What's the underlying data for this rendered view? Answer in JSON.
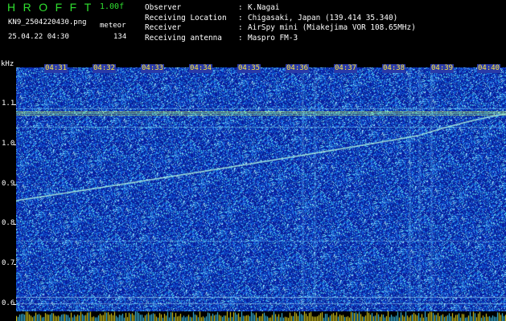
{
  "header": {
    "app_title": "HROFFT",
    "version": "1.00f",
    "filename": "KN9_2504220430.png",
    "mode": "meteor",
    "datetime": "25.04.22 04:30",
    "count": "134"
  },
  "meta": [
    {
      "key": "Observer",
      "value": "K.Nagai"
    },
    {
      "key": "Receiving Location",
      "value": "Chigasaki, Japan (139.414 35.340)"
    },
    {
      "key": "Receiver",
      "value": "AirSpy mini (Miakejima VOR 108.65MHz)"
    },
    {
      "key": "Receiving antenna",
      "value": "Maspro FM-3"
    }
  ],
  "axis": {
    "y_unit": "kHz",
    "y_ticks": [
      "1.1",
      "1.0",
      "0.9",
      "0.8",
      "0.7",
      "0.6"
    ],
    "time_labels": [
      "04:31",
      "04:32",
      "04:33",
      "04:34",
      "04:35",
      "04:36",
      "04:37",
      "04:38",
      "04:39",
      "04:40"
    ]
  },
  "colors": {
    "background": "#000000",
    "noise_low": "#0a1a9c",
    "noise_mid": "#2a6fe0",
    "noise_high": "#7fd8ff",
    "carrier": "#c8ff60",
    "accent": "#2fe02f",
    "time_label": "#ffe83a"
  }
}
